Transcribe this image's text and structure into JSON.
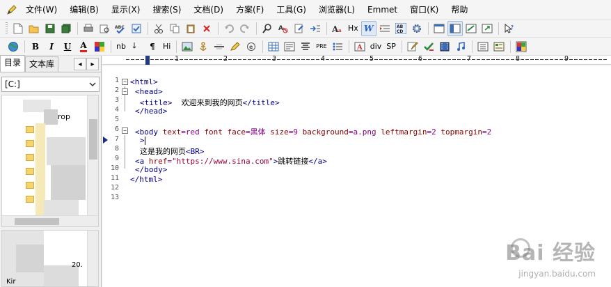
{
  "menu": {
    "items": [
      "文件(W)",
      "编辑(B)",
      "显示(X)",
      "搜索(S)",
      "文档(D)",
      "方案(F)",
      "工具(G)",
      "浏览器(L)",
      "Emmet",
      "窗口(K)",
      "帮助"
    ]
  },
  "toolbar2": {
    "bold": "B",
    "italic": "I",
    "underline": "U",
    "font_color": "A",
    "nb": "nb",
    "para": "¶",
    "h": "Hi",
    "pre": "PRE",
    "div": "div",
    "sp": "SP"
  },
  "toolbar1": {
    "hx": "Hx",
    "w": "W"
  },
  "sidebar": {
    "tabs": [
      "目录",
      "文本库"
    ],
    "arrow_left": "◂",
    "arrow_right": "▸",
    "drive": "[C:]",
    "tree_text": "rop",
    "file_text_1": "20.",
    "file_text_2": "Kir"
  },
  "ruler": {
    "labels": [
      "1",
      "2",
      "3",
      "4",
      "5",
      "6",
      "7",
      "8",
      "9"
    ]
  },
  "editor": {
    "line_numbers": [
      "1",
      "2",
      "3",
      "4",
      "5",
      "6",
      "7",
      "8",
      "9",
      "10",
      "11",
      "12",
      "13"
    ],
    "lines": {
      "l2_tag": "<html>",
      "l3_tag": "<head>",
      "l4_open": "<title>",
      "l4_text": "  欢迎来到我的网页",
      "l4_close": "</title>",
      "l5_tag": "</head>",
      "l7_tag": "<body",
      "l7_a1": " text",
      "l7_v1": "=red",
      "l7_a2": " font",
      "l7_a3": " face",
      "l7_v3": "=黑体",
      "l7_a4": " size",
      "l7_v4": "=9",
      "l7_a5": " background",
      "l7_v5": "=a.png",
      "l7_a6": " leftmargin",
      "l7_v6": "=2",
      "l7_a7": " topmargin",
      "l7_v7": "=2",
      "l8_tag": ">",
      "l9_text": "这是我的网页",
      "l9_tag": "<BR>",
      "l10_open": "<a",
      "l10_attr": " href",
      "l10_eq": "=",
      "l10_str": "\"https://www.sina.com\"",
      "l10_gt": ">",
      "l10_text": "跳转链接",
      "l10_close": "</a>",
      "l11_tag": "</body>",
      "l12_tag": "</html>"
    }
  },
  "watermark": {
    "main": "Bai  经验",
    "sub": "jingyan.baidu.com"
  }
}
